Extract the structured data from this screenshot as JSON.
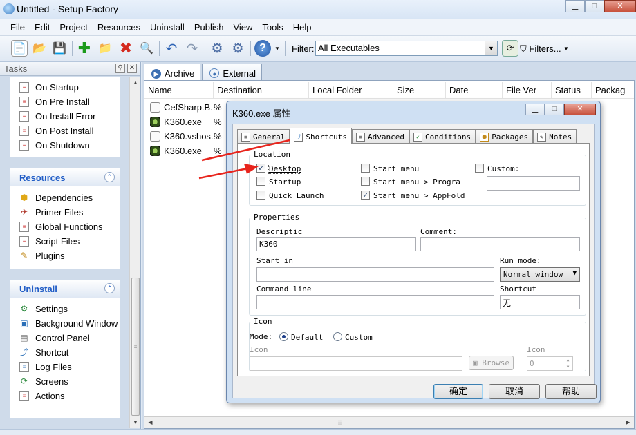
{
  "window": {
    "title": "Untitled - Setup Factory",
    "min": "▁",
    "max": "□",
    "close": "✕"
  },
  "menu": [
    "File",
    "Edit",
    "Project",
    "Resources",
    "Uninstall",
    "Publish",
    "View",
    "Tools",
    "Help"
  ],
  "toolbar": {
    "filter_label": "Filter:",
    "filter_value": "All Executables",
    "filters_button": "Filters..."
  },
  "tasks": {
    "header": "Tasks",
    "actions": [
      {
        "label": "On Startup",
        "icon": "script-icon"
      },
      {
        "label": "On Pre Install",
        "icon": "script-icon"
      },
      {
        "label": "On Install Error",
        "icon": "script-icon"
      },
      {
        "label": "On Post Install",
        "icon": "script-icon"
      },
      {
        "label": "On Shutdown",
        "icon": "script-icon"
      }
    ],
    "resources": {
      "title": "Resources",
      "items": [
        {
          "label": "Dependencies",
          "icon": "dependencies-icon"
        },
        {
          "label": "Primer Files",
          "icon": "primer-files-icon"
        },
        {
          "label": "Global Functions",
          "icon": "global-functions-icon"
        },
        {
          "label": "Script Files",
          "icon": "script-files-icon"
        },
        {
          "label": "Plugins",
          "icon": "plugins-icon"
        }
      ]
    },
    "uninstall": {
      "title": "Uninstall",
      "items": [
        {
          "label": "Settings",
          "icon": "settings-icon"
        },
        {
          "label": "Background Window",
          "icon": "background-window-icon"
        },
        {
          "label": "Control Panel",
          "icon": "control-panel-icon"
        },
        {
          "label": "Shortcut",
          "icon": "shortcut-icon"
        },
        {
          "label": "Log Files",
          "icon": "log-files-icon"
        },
        {
          "label": "Screens",
          "icon": "screens-icon"
        },
        {
          "label": "Actions",
          "icon": "actions-icon"
        }
      ]
    }
  },
  "main": {
    "tabs": [
      {
        "label": "Archive",
        "active": true
      },
      {
        "label": "External",
        "active": false
      }
    ],
    "columns": [
      "Name",
      "Destination",
      "Local Folder",
      "Size",
      "Date",
      "File Ver",
      "Status",
      "Packag"
    ],
    "files": [
      {
        "name": "CefSharp.B...",
        "dest": "%",
        "icon": "page"
      },
      {
        "name": "K360.exe",
        "dest": "%",
        "icon": "k360"
      },
      {
        "name": "K360.vshos...",
        "dest": "%",
        "icon": "page"
      },
      {
        "name": "K360.exe",
        "dest": "%",
        "icon": "k360"
      }
    ]
  },
  "dialog": {
    "title": "K360.exe 属性",
    "tabs": [
      {
        "label": "General",
        "active": false
      },
      {
        "label": "Shortcuts",
        "active": true
      },
      {
        "label": "Advanced",
        "active": false
      },
      {
        "label": "Conditions",
        "active": false
      },
      {
        "label": "Packages",
        "active": false
      },
      {
        "label": "Notes",
        "active": false
      }
    ],
    "location": {
      "legend": "Location",
      "desktop": {
        "label": "Desktop",
        "checked": true
      },
      "startup": {
        "label": "Startup",
        "checked": false
      },
      "quick_launch": {
        "label": "Quick Launch",
        "checked": false
      },
      "start_menu": {
        "label": "Start menu",
        "checked": false
      },
      "start_menu_programs": {
        "label": "Start menu > Progra",
        "checked": false
      },
      "start_menu_appfolder": {
        "label": "Start menu > AppFold",
        "checked": true
      },
      "custom": {
        "label": "Custom:",
        "checked": false,
        "value": ""
      }
    },
    "properties": {
      "legend": "Properties",
      "description_label": "Descriptic",
      "description_value": "K360",
      "comment_label": "Comment:",
      "comment_value": "",
      "start_in_label": "Start in",
      "start_in_value": "",
      "run_mode_label": "Run mode:",
      "run_mode_value": "Normal window",
      "command_line_label": "Command line",
      "command_line_value": "",
      "shortcut_label": "Shortcut",
      "shortcut_value": "无"
    },
    "icon": {
      "legend": "Icon",
      "mode_label": "Mode:",
      "default_label": "Default",
      "custom_label": "Custom",
      "icon_label": "Icon",
      "icon_value": "",
      "browse_label": "Browse",
      "index_label": "Icon",
      "index_value": "0"
    },
    "buttons": {
      "ok": "确定",
      "cancel": "取消",
      "help": "帮助"
    }
  },
  "annotation_color": "#e8241c"
}
